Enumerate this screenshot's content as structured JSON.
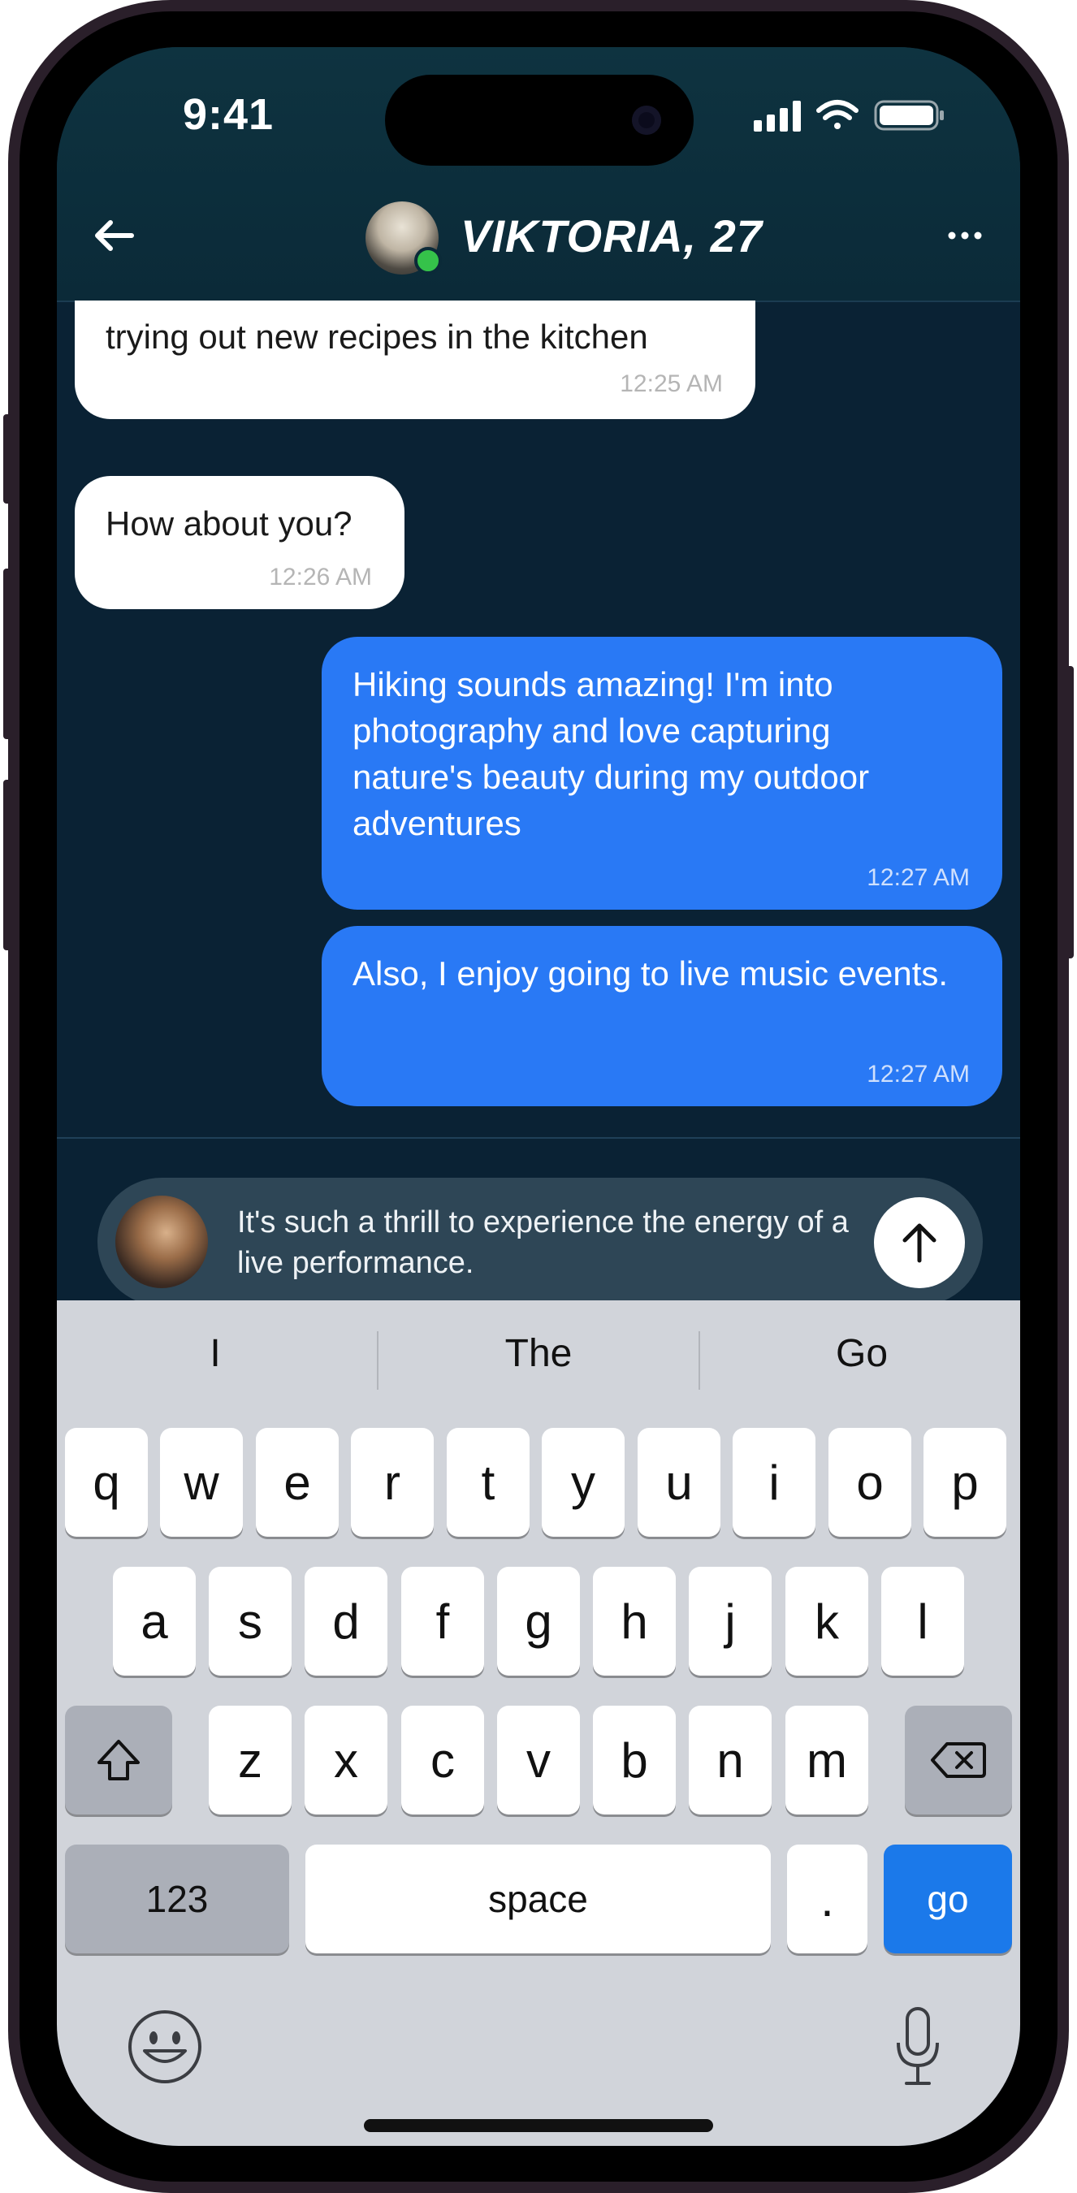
{
  "status_bar": {
    "time": "9:41"
  },
  "header": {
    "title": "VIKTORIA, 27",
    "online": true
  },
  "messages": [
    {
      "text": "trying out new recipes in the kitchen",
      "time": "12:25 AM",
      "from": "them"
    },
    {
      "text": "How about you?",
      "time": "12:26 AM",
      "from": "them"
    },
    {
      "text": "Hiking sounds amazing! I'm into photography and love capturing nature's beauty during my outdoor adventures",
      "time": "12:27 AM",
      "from": "me"
    },
    {
      "text": "Also, I enjoy going to live music events.",
      "time": "12:27 AM",
      "from": "me"
    }
  ],
  "composer": {
    "text": "It's such a thrill to experience the energy of a live performance."
  },
  "keyboard": {
    "predictions": [
      "I",
      "The",
      "Go"
    ],
    "row1": [
      "q",
      "w",
      "e",
      "r",
      "t",
      "y",
      "u",
      "i",
      "o",
      "p"
    ],
    "row2": [
      "a",
      "s",
      "d",
      "f",
      "g",
      "h",
      "j",
      "k",
      "l"
    ],
    "row3": [
      "z",
      "x",
      "c",
      "v",
      "b",
      "n",
      "m"
    ],
    "numbers_label": "123",
    "space_label": "space",
    "period_label": ".",
    "go_label": "go"
  },
  "colors": {
    "background": "#0a2234",
    "outgoing_bubble": "#2979f5",
    "incoming_bubble": "#ffffff",
    "composer": "#2e4656",
    "go_key": "#1b79ea",
    "online_dot": "#35c24a"
  }
}
